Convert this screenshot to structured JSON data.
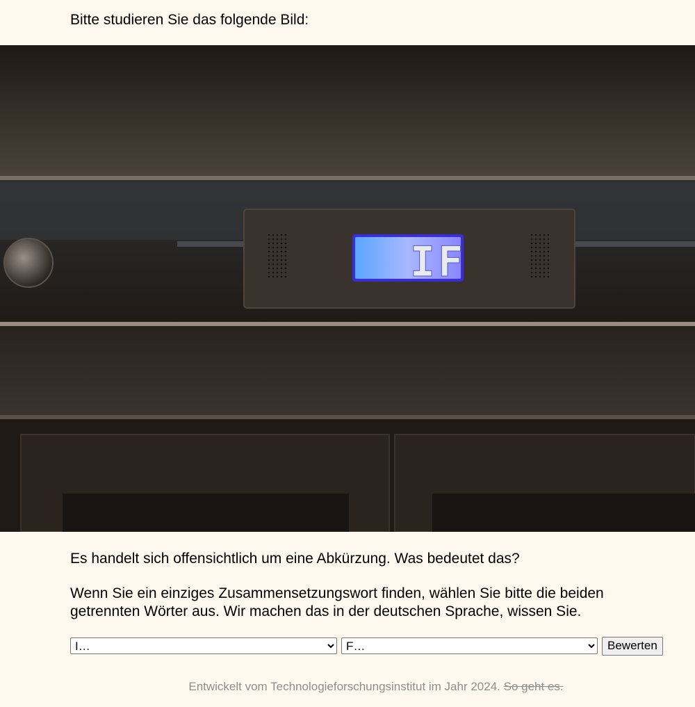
{
  "intro_text": "Bitte studieren Sie das folgende Bild:",
  "photo": {
    "display_text": "IF",
    "display_color": "#6a5cff"
  },
  "question": "Es handelt sich offensichtlich um eine Abkürzung. Was bedeutet das?",
  "instruction": "Wenn Sie ein einziges Zusammensetzungswort finden, wählen Sie bitte die beiden getrennten Wörter aus. Wir machen das in der deutschen Sprache, wissen Sie.",
  "form": {
    "select1_value": "I…",
    "select2_value": "F…",
    "submit_label": "Bewerten"
  },
  "footer": {
    "text": "Entwickelt vom Technologieforschungsinstitut im Jahr 2024.",
    "link_text": "So geht es."
  }
}
